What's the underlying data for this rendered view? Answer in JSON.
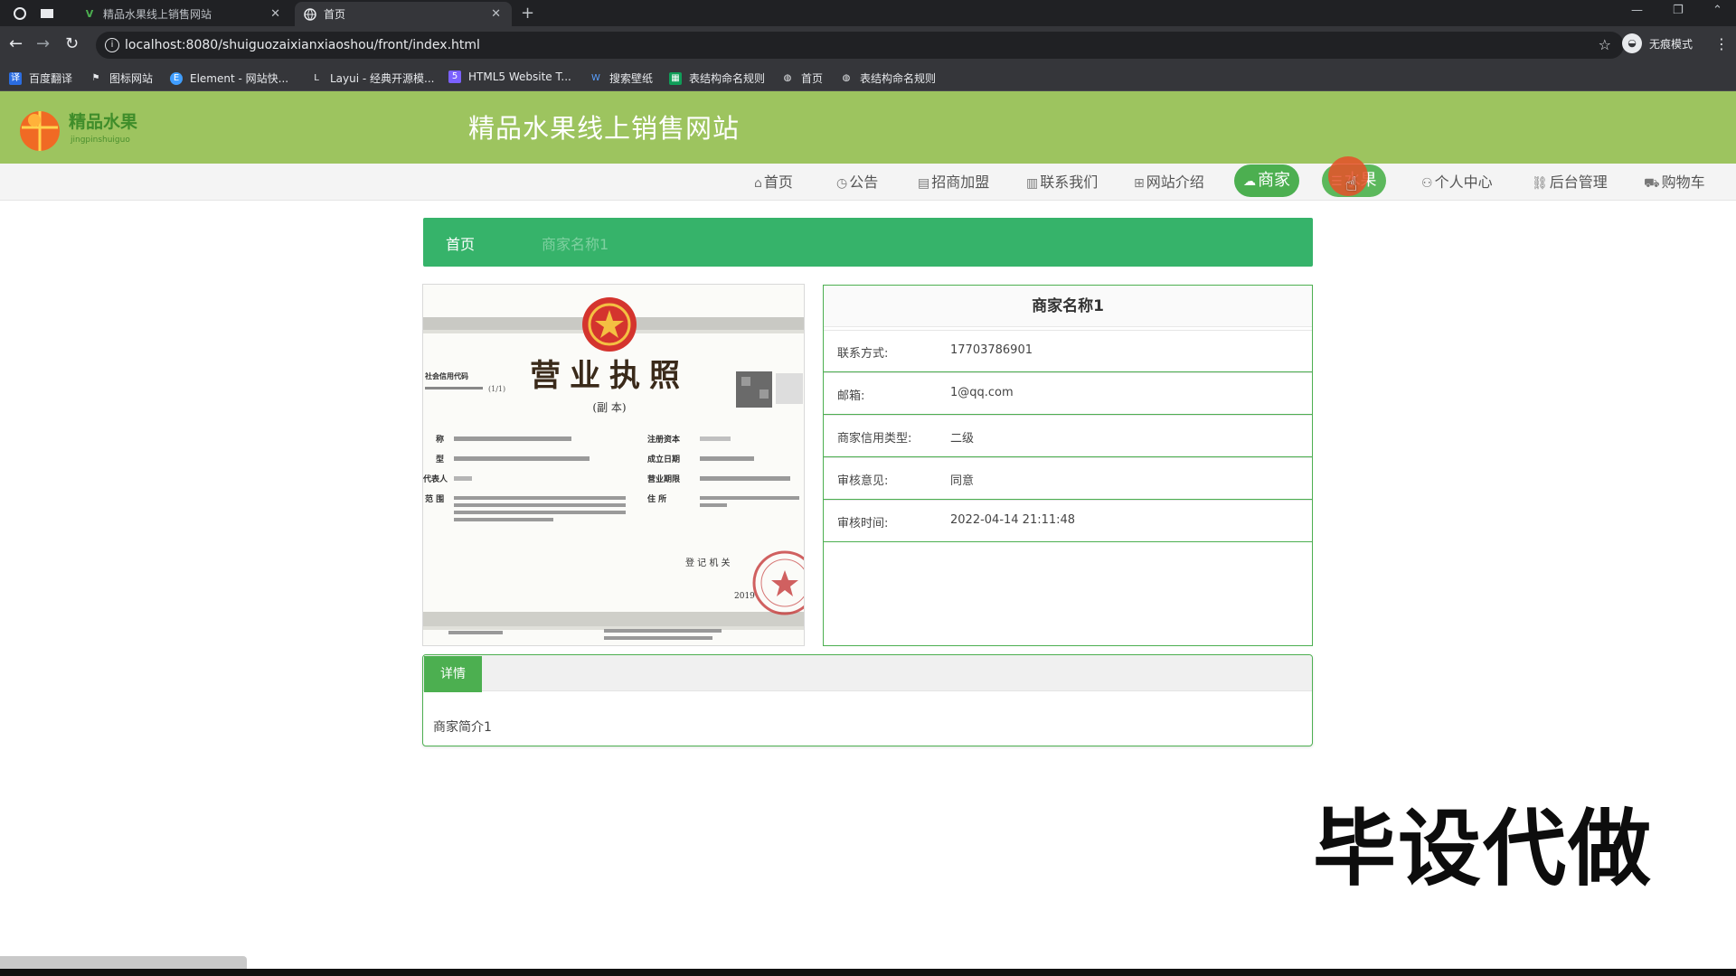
{
  "browser": {
    "tabs": [
      {
        "title": "精品水果线上销售网站",
        "active": false
      },
      {
        "title": "首页",
        "active": true
      }
    ],
    "new_tab": "+",
    "url": "localhost:8080/shuiguozaixianxiaoshou/front/index.html",
    "incognito_label": "无痕模式",
    "bookmarks": [
      {
        "label": "百度翻译",
        "icon": "translate-icon"
      },
      {
        "label": "图标网站",
        "icon": "flag-icon"
      },
      {
        "label": "Element - 网站快...",
        "icon": "element-icon"
      },
      {
        "label": "Layui - 经典开源模...",
        "icon": "layui-icon"
      },
      {
        "label": "HTML5 Website T...",
        "icon": "html5-icon"
      },
      {
        "label": "搜索壁纸",
        "icon": "wallpaper-icon"
      },
      {
        "label": "表结构命名规则",
        "icon": "sheet-icon"
      },
      {
        "label": "首页",
        "icon": "globe-icon"
      },
      {
        "label": "表结构命名规则",
        "icon": "globe-icon"
      }
    ]
  },
  "site": {
    "title": "精品水果线上销售网站",
    "logo_text": "精品水果",
    "colors": {
      "header": "#9dc45f",
      "accent": "#4caf50",
      "breadcrumb": "#36b36a"
    }
  },
  "nav": [
    {
      "label": "首页",
      "icon": "home-icon"
    },
    {
      "label": "公告",
      "icon": "notice-icon"
    },
    {
      "label": "招商加盟",
      "icon": "join-icon"
    },
    {
      "label": "联系我们",
      "icon": "contact-icon"
    },
    {
      "label": "网站介绍",
      "icon": "intro-icon"
    },
    {
      "label": "商家",
      "icon": "store-icon",
      "state": "active"
    },
    {
      "label": "水果",
      "icon": "fruit-icon",
      "state": "hover"
    },
    {
      "label": "个人中心",
      "icon": "user-icon"
    },
    {
      "label": "后台管理",
      "icon": "link-icon"
    },
    {
      "label": "购物车",
      "icon": "cart-icon"
    }
  ],
  "breadcrumb": {
    "home": "首页",
    "current": "商家名称1"
  },
  "merchant": {
    "name": "商家名称1",
    "fields": [
      {
        "label": "联系方式:",
        "value": "17703786901"
      },
      {
        "label": "邮箱:",
        "value": "1@qq.com"
      },
      {
        "label": "商家信用类型:",
        "value": "二级"
      },
      {
        "label": "审核意见:",
        "value": "同意"
      },
      {
        "label": "审核时间:",
        "value": "2022-04-14 21:11:48"
      }
    ]
  },
  "license": {
    "title": "营业执照",
    "subtitle": "(副 本)",
    "credit_code_label": "社会信用代码",
    "page": "(1/1)",
    "left_labels": [
      "称",
      "型",
      "代表人",
      "范 围"
    ],
    "right_labels": [
      "注册资本",
      "成立日期",
      "营业期限",
      "住 所"
    ],
    "authority": "登 记 机 关",
    "year": "2019"
  },
  "details": {
    "tab": "详情",
    "body": "商家简介1"
  },
  "watermark": "毕设代做"
}
